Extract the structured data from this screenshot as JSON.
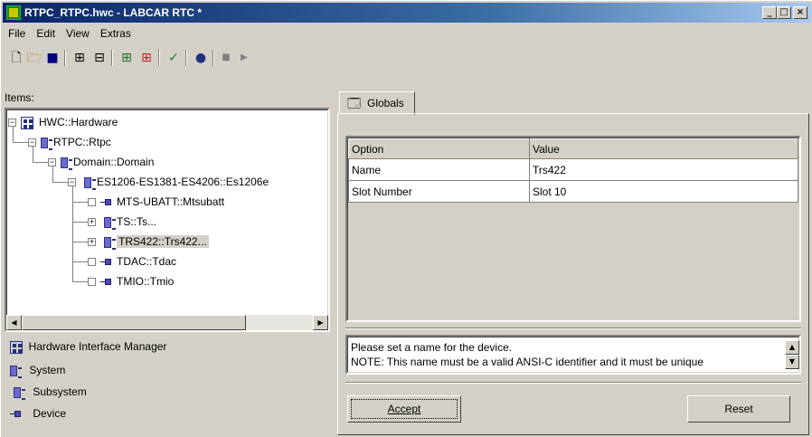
{
  "window": {
    "title": "RTPC_RTPC.hwc - LABCAR RTC  *",
    "min_glyph": "_",
    "max_glyph": "□",
    "close_glyph": "×"
  },
  "menu": [
    "File",
    "Edit",
    "View",
    "Extras"
  ],
  "toolbar": {
    "icons": [
      "new-file-icon",
      "open-folder-icon",
      "save-icon",
      "add-node-icon",
      "remove-node-icon",
      "import-icon",
      "export-icon",
      "check-icon",
      "user-icon",
      "stop-icon",
      "play-icon"
    ]
  },
  "items_label": "Items:",
  "tree": [
    {
      "label": "HWC::Hardware",
      "type": "hardware",
      "expanded": true,
      "level": 0
    },
    {
      "label": "RTPC::Rtpc",
      "type": "system",
      "expanded": true,
      "level": 1
    },
    {
      "label": "Domain::Domain",
      "type": "system",
      "expanded": true,
      "level": 2
    },
    {
      "label": "ES1206-ES1381-ES4206::Es1206e",
      "type": "subsystem",
      "expanded": true,
      "level": 3
    },
    {
      "label": "MTS-UBATT::Mtsubatt",
      "type": "device",
      "expanded": null,
      "level": 4
    },
    {
      "label": "TS::Ts...",
      "type": "subsystem",
      "expanded": false,
      "level": 4
    },
    {
      "label": "TRS422::Trs422...",
      "type": "subsystem",
      "expanded": false,
      "level": 4,
      "selected": true
    },
    {
      "label": "TDAC::Tdac",
      "type": "device",
      "expanded": null,
      "level": 4
    },
    {
      "label": "TMIO::Tmio",
      "type": "device",
      "expanded": null,
      "level": 4
    }
  ],
  "legend": [
    {
      "label": "Hardware Interface Manager",
      "icon": "hardware-icon"
    },
    {
      "label": "System",
      "icon": "system-icon"
    },
    {
      "label": "Subsystem",
      "icon": "subsystem-icon"
    },
    {
      "label": "Device",
      "icon": "device-icon"
    }
  ],
  "tab": {
    "label": "Globals",
    "icon": "globals-icon"
  },
  "table": {
    "headers": [
      "Option",
      "Value"
    ],
    "rows": [
      [
        "Name",
        "Trs422"
      ],
      [
        "Slot Number",
        "Slot 10"
      ]
    ]
  },
  "hint": {
    "line1": "Please set a name for the device.",
    "line2": "NOTE: This name must be a valid ANSI-C identifier and it must be unique"
  },
  "buttons": {
    "accept": "Accept",
    "reset": "Reset"
  }
}
